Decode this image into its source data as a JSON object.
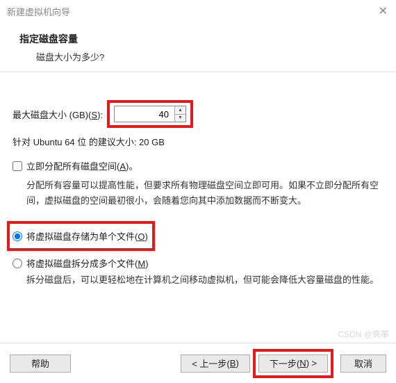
{
  "window": {
    "title": "新建虚拟机向导"
  },
  "header": {
    "title": "指定磁盘容量",
    "subtitle": "磁盘大小为多少?"
  },
  "disk": {
    "label_prefix": "最大磁盘大小 (GB)(",
    "label_key": "S",
    "label_suffix": "):",
    "value": "40",
    "recommended": "针对 Ubuntu 64 位 的建议大小: 20 GB"
  },
  "allocate": {
    "label_prefix": "立即分配所有磁盘空间(",
    "label_key": "A",
    "label_suffix": ")。",
    "desc": "分配所有容量可以提高性能，但要求所有物理磁盘空间立即可用。如果不立即分配所有空间，虚拟磁盘的空间最初很小，会随着您向其中添加数据而不断变大。"
  },
  "storage": {
    "single_prefix": "将虚拟磁盘存储为单个文件(",
    "single_key": "O",
    "single_suffix": ")",
    "split_prefix": "将虚拟磁盘拆分成多个文件(",
    "split_key": "M",
    "split_suffix": ")",
    "split_desc": "拆分磁盘后，可以更轻松地在计算机之间移动虚拟机，但可能会降低大容量磁盘的性能。"
  },
  "buttons": {
    "help": "帮助",
    "back_prefix": "< 上一步(",
    "back_key": "B",
    "back_suffix": ")",
    "next_prefix": "下一步(",
    "next_key": "N",
    "next_suffix": ") >",
    "cancel": "取消"
  },
  "watermark": "CSDN @疯筝"
}
